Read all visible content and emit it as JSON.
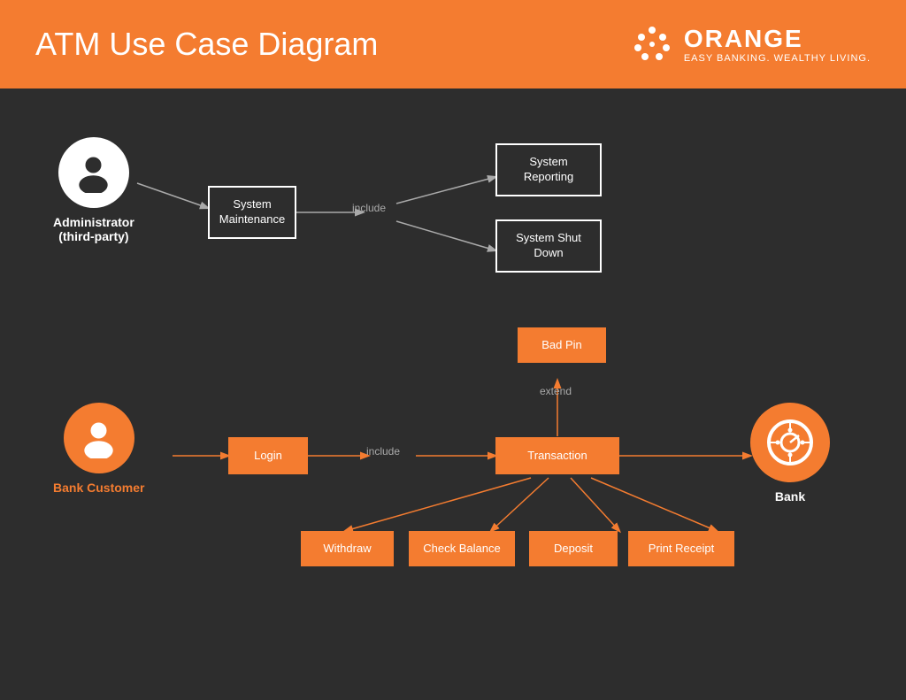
{
  "header": {
    "title": "ATM Use Case Diagram",
    "logo_name": "ORANGE",
    "logo_tagline": "EASY BANKING. WEALTHY LIVING."
  },
  "actors": {
    "administrator": {
      "label_line1": "Administrator",
      "label_line2": "(third-party)"
    },
    "bank_customer": {
      "label": "Bank Customer"
    },
    "bank": {
      "label": "Bank"
    }
  },
  "boxes": {
    "system_maintenance": "System Maintenance",
    "system_reporting": "System Reporting",
    "system_shut_down": "System Shut Down",
    "bad_pin": "Bad Pin",
    "login": "Login",
    "transaction": "Transaction",
    "withdraw": "Withdraw",
    "check_balance": "Check Balance",
    "deposit": "Deposit",
    "print_receipt": "Print Receipt"
  },
  "arrow_labels": {
    "include1": "include",
    "include2": "include",
    "extend": "extend"
  }
}
